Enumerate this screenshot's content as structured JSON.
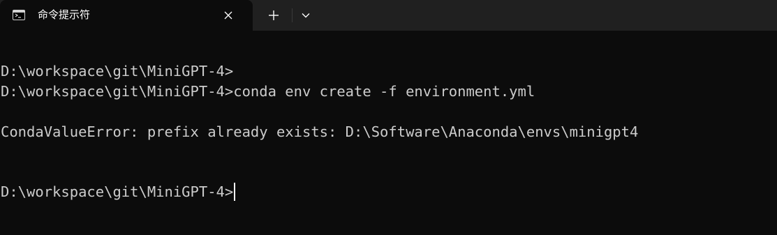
{
  "tab": {
    "title": "命令提示符",
    "icon": "cmd-icon"
  },
  "tabbar": {
    "close_icon": "close-icon",
    "new_tab_icon": "plus-icon",
    "dropdown_icon": "chevron-down-icon"
  },
  "terminal": {
    "lines": [
      "D:\\workspace\\git\\MiniGPT-4>",
      "D:\\workspace\\git\\MiniGPT-4>conda env create -f environment.yml",
      "CondaValueError: prefix already exists: D:\\Software\\Anaconda\\envs\\minigpt4",
      "D:\\workspace\\git\\MiniGPT-4>"
    ]
  },
  "colors": {
    "background": "#0c0c0c",
    "tabbar": "#202020",
    "text": "#cccccc",
    "cursor": "#ffffff"
  }
}
